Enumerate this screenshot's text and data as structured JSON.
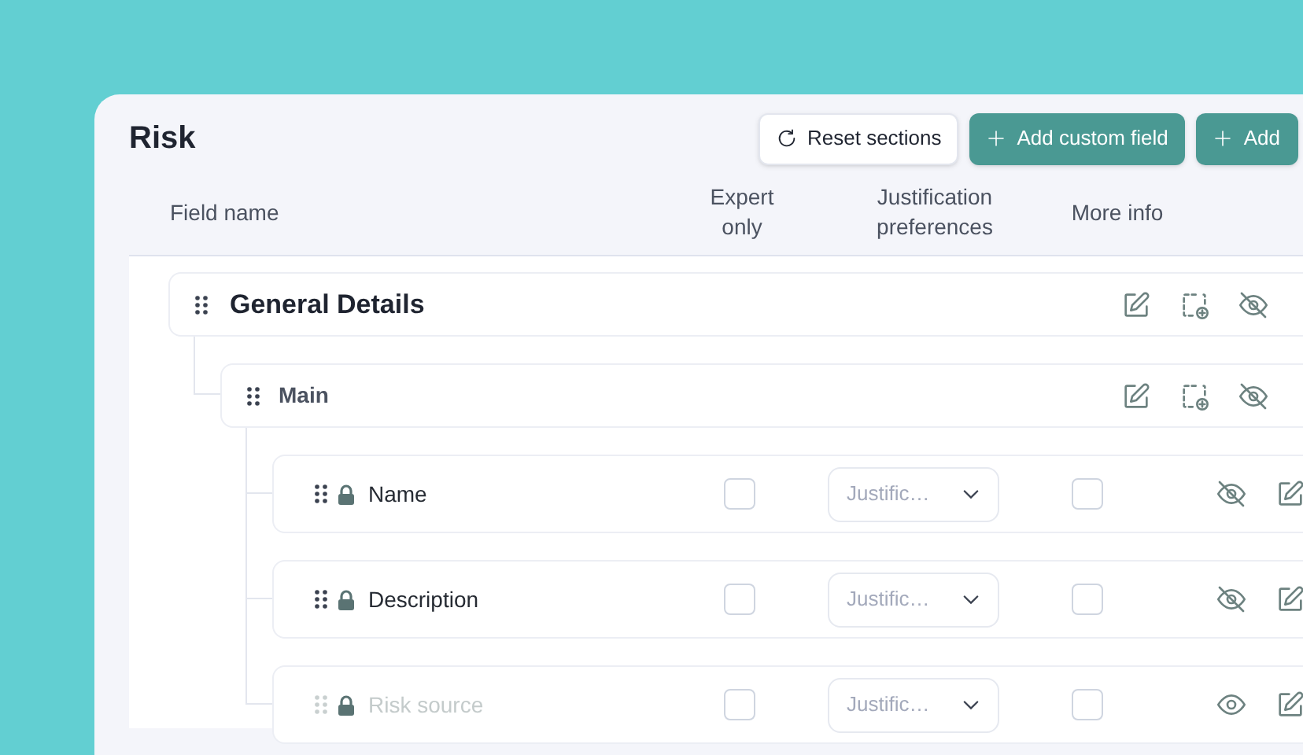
{
  "title": "Risk",
  "buttons": [
    {
      "kind": "reset",
      "label": "Reset sections"
    },
    {
      "kind": "add",
      "label": "Add custom field"
    },
    {
      "kind": "add",
      "label": "Add"
    }
  ],
  "columns": [
    "Field name",
    "Expert only",
    "Justification preferences",
    "More info"
  ],
  "tree": [
    {
      "kind": "section",
      "label": "General Details",
      "children": [
        {
          "kind": "section",
          "label": "Main",
          "children": [
            {
              "kind": "field",
              "label": "Name",
              "locked": true,
              "hidden": false,
              "expert_only": false,
              "justification_placeholder": "Justific…",
              "more_info": false
            },
            {
              "kind": "field",
              "label": "Description",
              "locked": true,
              "hidden": false,
              "expert_only": false,
              "justification_placeholder": "Justific…",
              "more_info": false
            },
            {
              "kind": "field",
              "label": "Risk source",
              "locked": true,
              "hidden": true,
              "expert_only": false,
              "justification_placeholder": "Justific…",
              "more_info": false
            }
          ]
        }
      ]
    }
  ]
}
